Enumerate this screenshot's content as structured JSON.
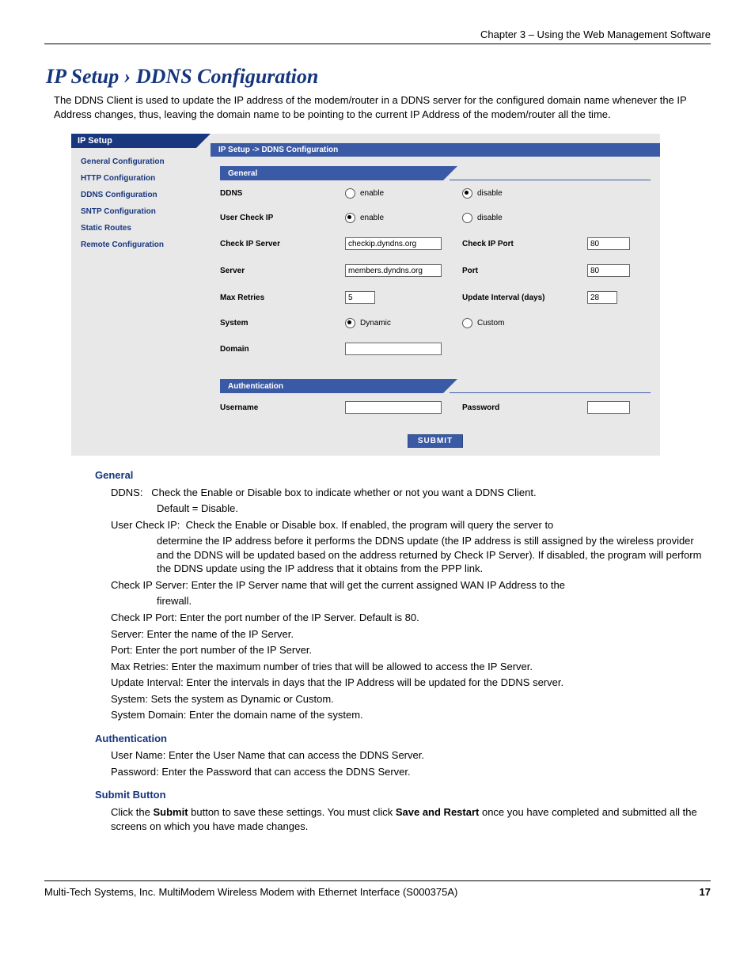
{
  "header": {
    "chapter": "Chapter 3 – Using the Web Management Software"
  },
  "title": "IP Setup › DDNS Configuration",
  "intro": "The DDNS Client is used to update the IP address of the modem/router in a DDNS server for the configured domain name whenever the IP Address changes, thus, leaving the domain name to be pointing to the current IP Address of the modem/router all the time.",
  "sidebar": {
    "tab": "IP Setup",
    "items": [
      "General Configuration",
      "HTTP Configuration",
      "DDNS Configuration",
      "SNTP Configuration",
      "Static Routes",
      "Remote Configuration"
    ]
  },
  "breadcrumb": "IP Setup  ->  DDNS Configuration",
  "sections": {
    "general_label": "General",
    "auth_label": "Authentication"
  },
  "form": {
    "ddns_label": "DDNS",
    "enable": "enable",
    "disable": "disable",
    "usercheckip_label": "User Check IP",
    "checkipserver_label": "Check IP Server",
    "checkipserver_val": "checkip.dyndns.org",
    "checkipport_label": "Check IP Port",
    "checkipport_val": "80",
    "server_label": "Server",
    "server_val": "members.dyndns.org",
    "port_label": "Port",
    "port_val": "80",
    "maxretries_label": "Max Retries",
    "maxretries_val": "5",
    "updateint_label": "Update Interval (days)",
    "updateint_val": "28",
    "system_label": "System",
    "dynamic": "Dynamic",
    "custom": "Custom",
    "domain_label": "Domain",
    "username_label": "Username",
    "password_label": "Password",
    "submit": "SUBMIT"
  },
  "help": {
    "general_h": "General",
    "ddns_t": "DDNS:",
    "ddns_d1": "Check the Enable or Disable box to indicate whether or not you want a DDNS Client.",
    "ddns_d2": "Default = Disable.",
    "uci_t": "User Check IP:",
    "uci_d": "Check the Enable or Disable box. If enabled, the program will query the server to determine the IP address before it performs the DDNS update (the IP address is still assigned by the wireless provider and the DDNS will be updated based on the address returned by Check IP Server). If disabled, the program will perform the DDNS update using the IP address that it obtains from the PPP link.",
    "cis_t": "Check IP Server:",
    "cis_d": "Enter the IP Server name that will get the current assigned WAN IP Address to the firewall.",
    "cip_t": "Check IP Port:",
    "cip_d": "Enter the port number of the IP Server. Default is 80.",
    "srv_t": "Server:",
    "srv_d": "Enter the name of the IP Server.",
    "prt_t": "Port:",
    "prt_d": "Enter the port number of the IP Server.",
    "mr_t": "Max Retries:",
    "mr_d": "Enter the maximum number of tries that will be allowed to access the IP Server.",
    "ui_t": "Update Interval:",
    "ui_d": "Enter the intervals in days that the IP Address will be updated for the DDNS server.",
    "sys_t": "System:",
    "sys_d": "Sets the system as Dynamic or Custom.",
    "sd_t": "System Domain:",
    "sd_d": "Enter the domain name of the system.",
    "auth_h": "Authentication",
    "un_t": "User Name:",
    "un_d": "Enter the User Name that can access the DDNS Server.",
    "pw_t": "Password:",
    "pw_d": "Enter the Password that can access the DDNS Server.",
    "submit_h": "Submit Button",
    "submit_p1a": "Click the ",
    "submit_p1b": "Submit",
    "submit_p1c": " button to save these settings. You must click ",
    "submit_p1d": "Save and Restart",
    "submit_p1e": " once you have completed and submitted all the screens on which you have made changes."
  },
  "footer": {
    "left": "Multi-Tech Systems, Inc. MultiModem Wireless Modem with Ethernet Interface (S000375A)",
    "right": "17"
  }
}
